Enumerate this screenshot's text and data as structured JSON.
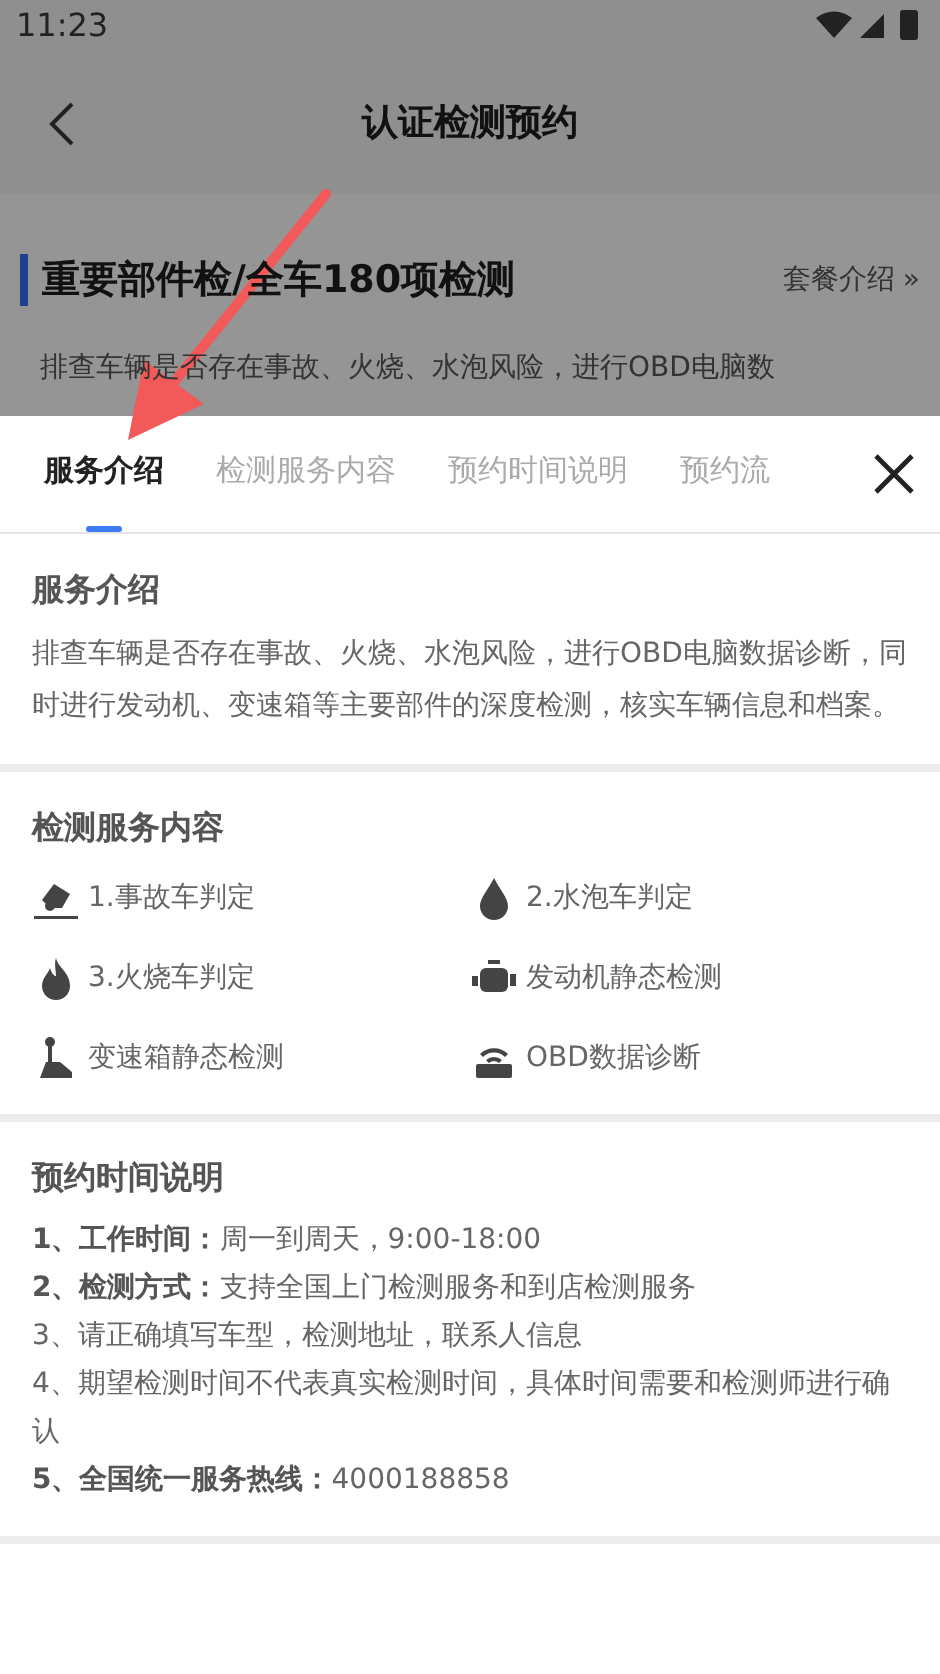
{
  "status_bar": {
    "time": "11:23"
  },
  "header": {
    "title": "认证检测预约"
  },
  "package": {
    "title": "重要部件检/全车180项检测",
    "link": "套餐介绍",
    "link_icon": "»",
    "summary": "排查车辆是否存在事故、火烧、水泡风险，进行OBD电脑数"
  },
  "tabs": [
    {
      "label": "服务介绍",
      "selected": true
    },
    {
      "label": "检测服务内容",
      "selected": false
    },
    {
      "label": "预约时间说明",
      "selected": false
    },
    {
      "label": "预约流",
      "selected": false
    }
  ],
  "sections": [
    {
      "kind": "text",
      "title": "服务介绍",
      "body": "排查车辆是否存在事故、火烧、水泡风险，进行OBD电脑数据诊断，同时进行发动机、变速箱等主要部件的深度检测，核实车辆信息和档案。"
    },
    {
      "kind": "grid",
      "title": "检测服务内容",
      "items": [
        {
          "label": "1.事故车判定"
        },
        {
          "label": "2.水泡车判定"
        },
        {
          "label": "3.火烧车判定"
        },
        {
          "label": "发动机静态检测"
        },
        {
          "label": "变速箱静态检测"
        },
        {
          "label": "OBD数据诊断"
        }
      ]
    },
    {
      "kind": "list",
      "title": "预约时间说明",
      "lines": [
        "**1、工作时间：**周一到周天，9:00-18:00",
        "**2、检测方式：**支持全国上门检测服务和到店检测服务",
        "3、请正确填写车型，检测地址，联系人信息",
        "4、期望检测时间不代表真实检测时间，具体时间需要和检测师进行确认",
        "**5、全国统一服务热线：**4000188858"
      ]
    }
  ]
}
